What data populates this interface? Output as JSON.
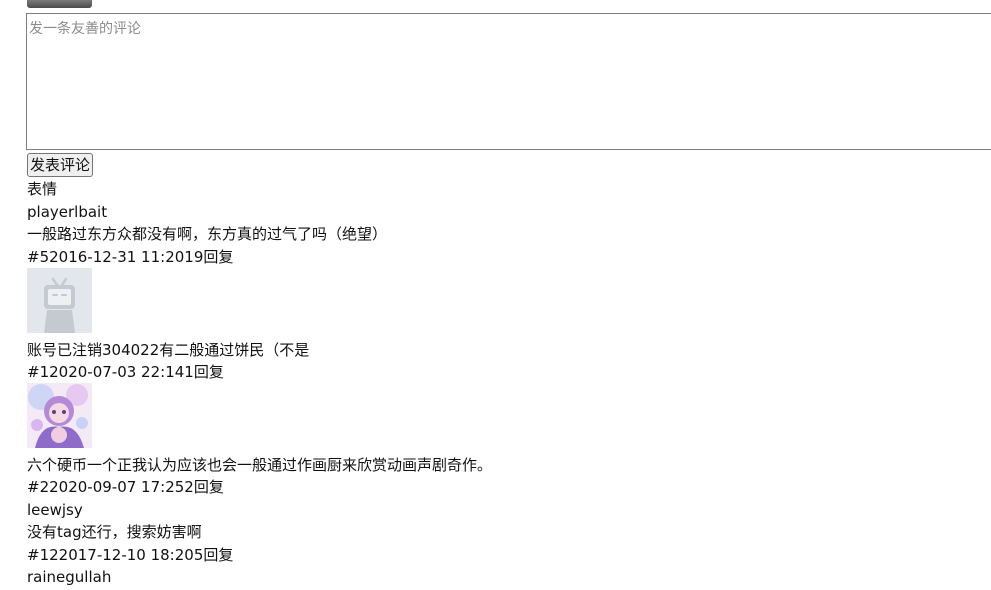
{
  "editor": {
    "placeholder": "发一条友善的评论",
    "submit_label": "发表评论",
    "emoji_label": "表情"
  },
  "comments": [
    {
      "user": "playerlbait",
      "text": "一般路过东方众都没有啊，东方真的过气了吗（绝望）",
      "meta": "#52016-12-31 11:2019回复"
    },
    {
      "user": "",
      "text": "账号已注销304022有二般通过饼民（不是",
      "meta": "#12020-07-03 22:141回复",
      "avatar": "default-tv-avatar"
    },
    {
      "user": "",
      "text": "六个硬币一个正我认为应该也会一般通过作画厨来欣赏动画声剧奇作。",
      "meta": "#22020-09-07 17:252回复",
      "avatar": "anime-girl-avatar"
    },
    {
      "user": "leewjsy",
      "text": "没有tag还行，搜索妨害啊",
      "meta": "#122017-12-10 18:205回复"
    },
    {
      "user": "rainegullah",
      "text": "",
      "meta": ""
    }
  ]
}
